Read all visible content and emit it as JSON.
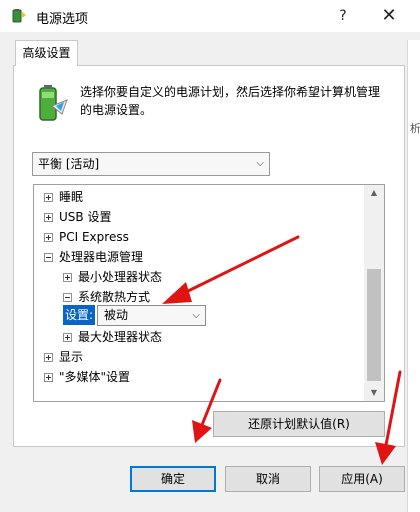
{
  "window": {
    "title": "电源选项",
    "help": "?",
    "close": "✕"
  },
  "tabs": [
    {
      "label": "高级设置"
    }
  ],
  "description": "选择你要自定义的电源计划，然后选择你希望计算机管理的电源设置。",
  "plan_select": {
    "value": "平衡 [活动]"
  },
  "tree": {
    "items": [
      {
        "label": "睡眠"
      },
      {
        "label": "USB 设置"
      },
      {
        "label": "PCI Express"
      },
      {
        "label": "处理器电源管理"
      },
      {
        "label": "最小处理器状态"
      },
      {
        "label": "系统散热方式"
      },
      {
        "label": "最大处理器状态"
      },
      {
        "label": "显示"
      },
      {
        "label": "\"多媒体\"设置"
      }
    ],
    "setting_label": "设置:",
    "setting_value": "被动"
  },
  "background_glyph": "析",
  "buttons": {
    "restore": "还原计划默认值(R)",
    "ok": "确定",
    "cancel": "取消",
    "apply": "应用(A)"
  },
  "colors": {
    "accent": "#0078d7",
    "highlight": "#0a64c8",
    "annotation_arrow": "#e11414"
  }
}
